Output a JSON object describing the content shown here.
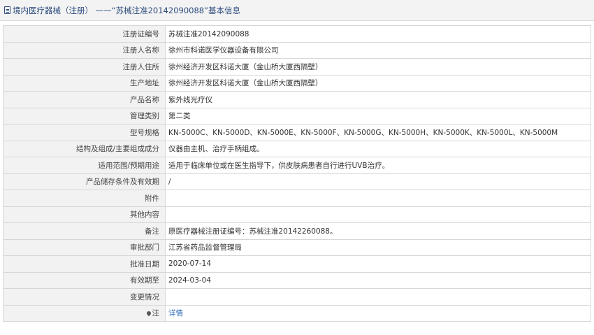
{
  "header": {
    "icon": "document-icon",
    "title": "境内医疗器械（注册） ——“苏械注准20142090088”基本信息"
  },
  "rows": [
    {
      "label": "注册证编号",
      "value": "苏械注准20142090088"
    },
    {
      "label": "注册人名称",
      "value": "徐州市科诺医学仪器设备有限公司"
    },
    {
      "label": "注册人住所",
      "value": "徐州经济开发区科诺大厦（金山桥大厦西隔壁）"
    },
    {
      "label": "生产地址",
      "value": "徐州经济开发区科诺大厦（金山桥大厦西隔壁）"
    },
    {
      "label": "产品名称",
      "value": "紫外线光疗仪"
    },
    {
      "label": "管理类别",
      "value": "第二类"
    },
    {
      "label": "型号规格",
      "value": "KN-5000C、KN-5000D、KN-5000E、KN-5000F、KN-5000G、KN-5000H、KN-5000K、KN-5000L、KN-5000M"
    },
    {
      "label": "结构及组成/主要组成成分",
      "value": "仪器由主机、治疗手柄组成。"
    },
    {
      "label": "适用范围/预期用途",
      "value": "适用于临床单位或在医生指导下，供皮肤病患者自行进行UVB治疗。"
    },
    {
      "label": "产品储存条件及有效期",
      "value": "/"
    },
    {
      "label": "附件",
      "value": ""
    },
    {
      "label": "其他内容",
      "value": ""
    },
    {
      "label": "备注",
      "value": "原医疗器械注册证编号：苏械注准20142260088。"
    },
    {
      "label": "审批部门",
      "value": "江苏省药品监督管理局"
    },
    {
      "label": "批准日期",
      "value": "2020-07-14"
    },
    {
      "label": "有效期至",
      "value": "2024-03-04"
    },
    {
      "label": "变更情况",
      "value": ""
    }
  ],
  "note_row": {
    "icon": "pin-icon",
    "label": "注",
    "link_text": "详情"
  }
}
